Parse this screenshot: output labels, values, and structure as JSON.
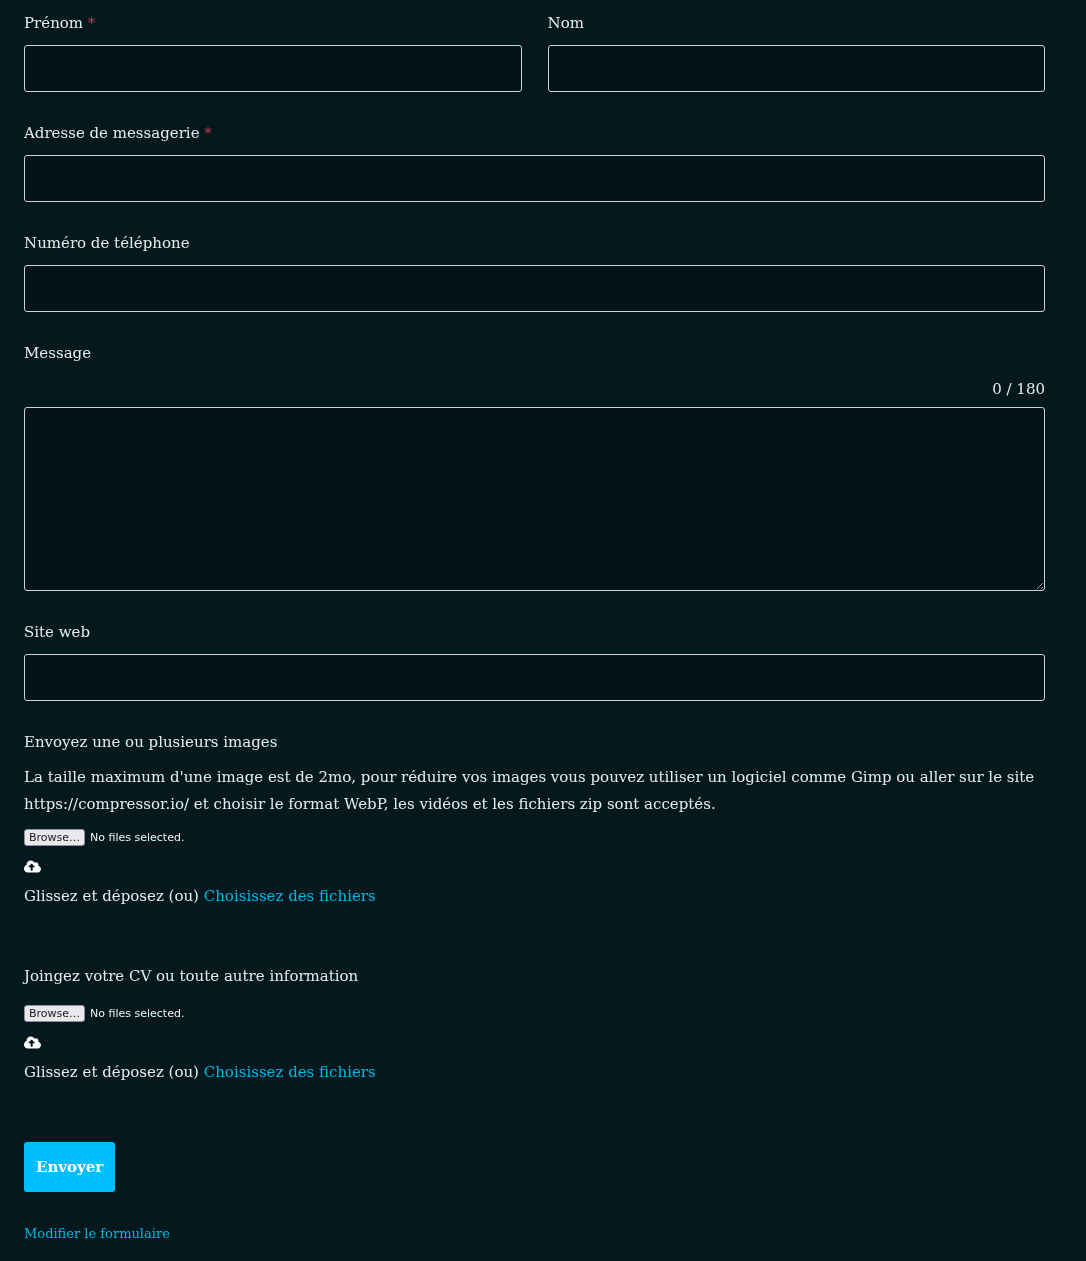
{
  "name_row": [
    {
      "label": "Prénom",
      "required_mark": "*"
    },
    {
      "label": "Nom"
    }
  ],
  "fields": [
    {
      "kind": "input",
      "label": "Adresse de messagerie",
      "required_mark": "*"
    },
    {
      "kind": "input",
      "label": "Numéro de téléphone"
    },
    {
      "kind": "textarea",
      "label": "Message",
      "counter": "0 / 180"
    },
    {
      "kind": "input",
      "label": "Site web"
    }
  ],
  "uploads": [
    {
      "label": "Envoyez une ou plusieurs images",
      "description": "La taille maximum d'une image est de 2mo, pour réduire vos images vous pouvez utiliser un logiciel comme Gimp ou aller sur le site https://compressor.io/ et choisir le format WebP, les vidéos et les fichiers zip sont acceptés.",
      "browse_button": "Browse…",
      "file_status": "No files selected.",
      "drop_text": "Glissez et déposez (ou)",
      "choose_link": "Choisissez des fichiers"
    },
    {
      "label": "Joingez votre CV ou toute autre information",
      "browse_button": "Browse…",
      "file_status": "No files selected.",
      "drop_text": "Glissez et déposez (ou)",
      "choose_link": "Choisissez des fichiers"
    }
  ],
  "submit_button": "Envoyer",
  "edit_link": "Modifier le formulaire"
}
